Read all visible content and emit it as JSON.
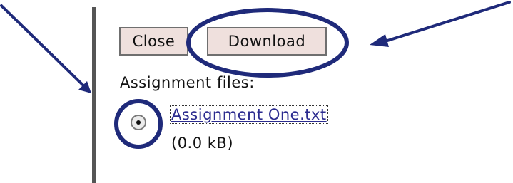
{
  "toolbar": {
    "close_label": "Close",
    "download_label": "Download"
  },
  "assignment": {
    "files_label": "Assignment files:",
    "files": [
      {
        "name": "Assignment One.txt",
        "size": "(0.0 kB)",
        "selected": true
      }
    ]
  },
  "annotations": {
    "color": "#1f2a7a",
    "items": [
      "arrow-to-vertical-line",
      "arrow-to-download-button",
      "circle-around-download-button",
      "circle-around-radio-button"
    ]
  }
}
